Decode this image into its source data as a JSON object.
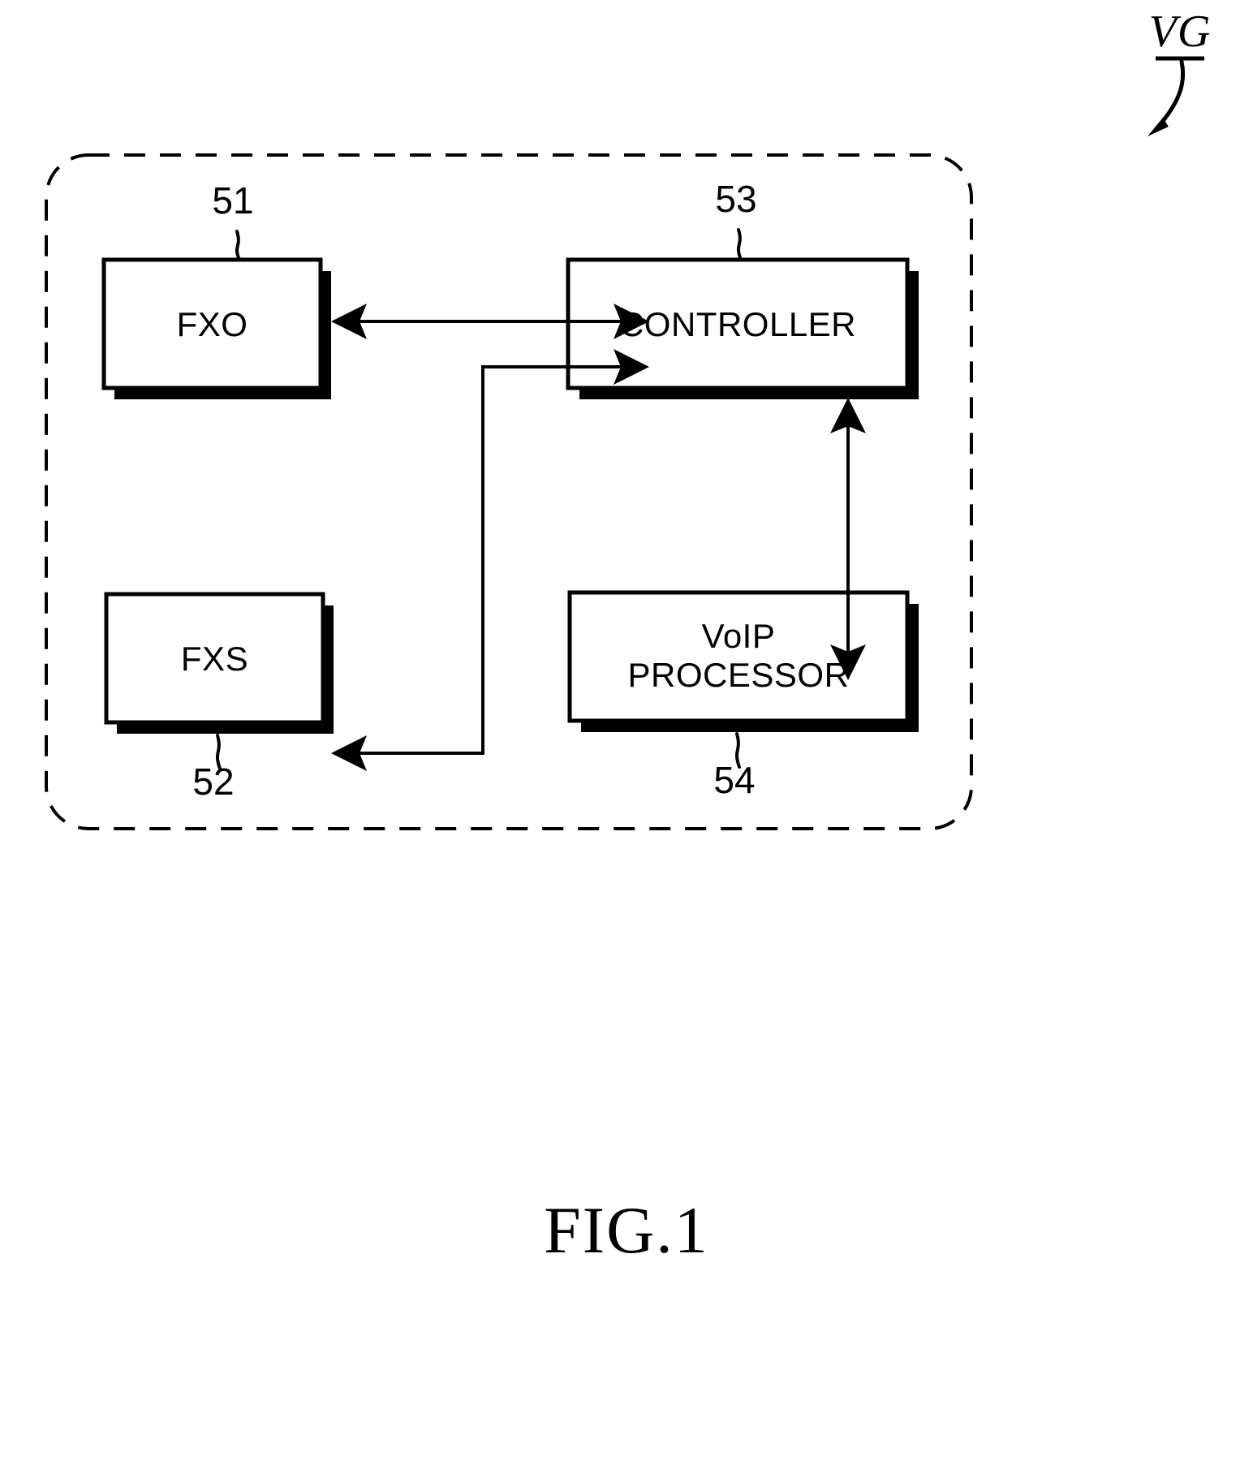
{
  "figure": {
    "caption": "FIG.1",
    "system_label": "VG",
    "blocks": [
      {
        "id": "fxo",
        "label": "FXO",
        "ref": "51",
        "ref_position": "above"
      },
      {
        "id": "fxs",
        "label": "FXS",
        "ref": "52",
        "ref_position": "below"
      },
      {
        "id": "controller",
        "label": "CONTROLLER",
        "ref": "53",
        "ref_position": "above"
      },
      {
        "id": "voip",
        "label_line1": "VoIP",
        "label_line2": "PROCESSOR",
        "ref": "54",
        "ref_position": "below"
      }
    ],
    "connections": [
      {
        "from": "fxo",
        "to": "controller",
        "type": "double-arrow"
      },
      {
        "from": "voip",
        "to": "controller",
        "type": "double-arrow"
      },
      {
        "from": "controller",
        "to": "fxs",
        "type": "single-arrow"
      }
    ],
    "colors": {
      "line": "#000000",
      "background": "#ffffff",
      "shadow": "#000000"
    }
  }
}
